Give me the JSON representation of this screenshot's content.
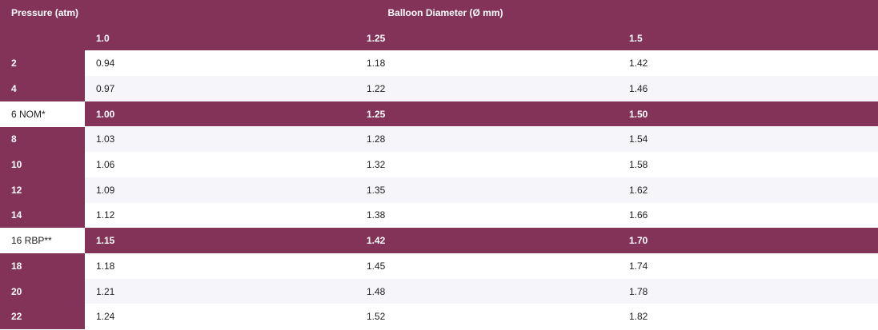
{
  "header": {
    "stub_label": "Pressure (atm)",
    "group_label": "Balloon Diameter (Ø mm)",
    "columns": [
      "1.0",
      "1.25",
      "1.5"
    ]
  },
  "rows": [
    {
      "pressure": "2",
      "values": [
        "0.94",
        "1.18",
        "1.42"
      ]
    },
    {
      "pressure": "4",
      "values": [
        "0.97",
        "1.22",
        "1.46"
      ]
    },
    {
      "pressure": "6 NOM*",
      "values": [
        "1.00",
        "1.25",
        "1.50"
      ]
    },
    {
      "pressure": "8",
      "values": [
        "1.03",
        "1.28",
        "1.54"
      ]
    },
    {
      "pressure": "10",
      "values": [
        "1.06",
        "1.32",
        "1.58"
      ]
    },
    {
      "pressure": "12",
      "values": [
        "1.09",
        "1.35",
        "1.62"
      ]
    },
    {
      "pressure": "14",
      "values": [
        "1.12",
        "1.38",
        "1.66"
      ]
    },
    {
      "pressure": "16 RBP**",
      "values": [
        "1.15",
        "1.42",
        "1.70"
      ]
    },
    {
      "pressure": "18",
      "values": [
        "1.18",
        "1.45",
        "1.74"
      ]
    },
    {
      "pressure": "20",
      "values": [
        "1.21",
        "1.48",
        "1.78"
      ]
    },
    {
      "pressure": "22",
      "values": [
        "1.24",
        "1.52",
        "1.82"
      ]
    }
  ],
  "colors": {
    "header_bg": "#833258",
    "header_text": "#ffffff",
    "row_alt_bg": "#f6f5fa"
  }
}
